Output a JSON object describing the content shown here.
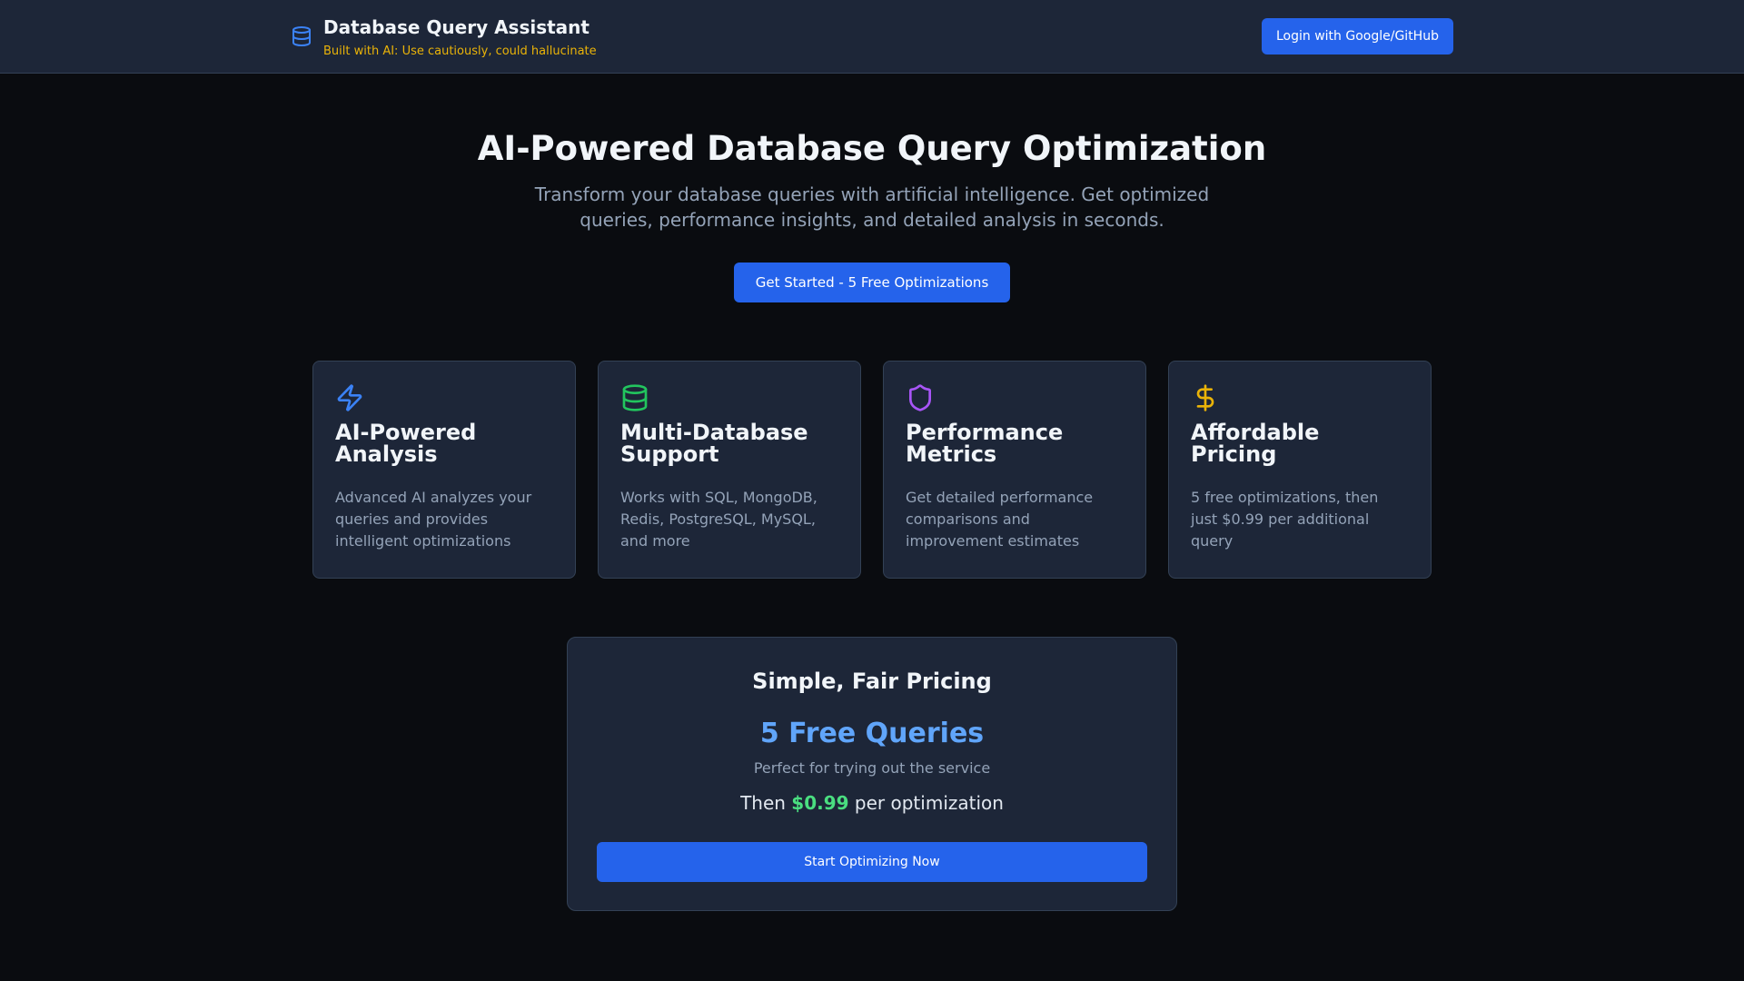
{
  "header": {
    "title": "Database Query Assistant",
    "subtitle": "Built with AI: Use cautiously, could hallucinate",
    "login_label": "Login with Google/GitHub",
    "icon": "database-icon"
  },
  "hero": {
    "title": "AI-Powered Database Query Optimization",
    "subtitle": "Transform your database queries with artificial intelligence. Get optimized queries, performance insights, and detailed analysis in seconds.",
    "cta_label": "Get Started - 5 Free Optimizations"
  },
  "features": [
    {
      "title": "AI-Powered Analysis",
      "text": "Advanced AI analyzes your queries and provides intelligent optimizations",
      "icon": "lightning-icon",
      "color": "#3b82f6"
    },
    {
      "title": "Multi-Database Support",
      "text": "Works with SQL, MongoDB, Redis, PostgreSQL, MySQL, and more",
      "icon": "database-icon",
      "color": "#22c55e"
    },
    {
      "title": "Performance Metrics",
      "text": "Get detailed performance comparisons and improvement estimates",
      "icon": "shield-icon",
      "color": "#a855f7"
    },
    {
      "title": "Affordable Pricing",
      "text": "5 free optimizations, then just $0.99 per additional query",
      "icon": "dollar-icon",
      "color": "#eab308"
    }
  ],
  "pricing": {
    "title": "Simple, Fair Pricing",
    "free": "5 Free Queries",
    "note": "Perfect for trying out the service",
    "then_prefix": "Then",
    "price": "$0.99",
    "then_suffix": "per optimization",
    "button_label": "Start Optimizing Now"
  }
}
